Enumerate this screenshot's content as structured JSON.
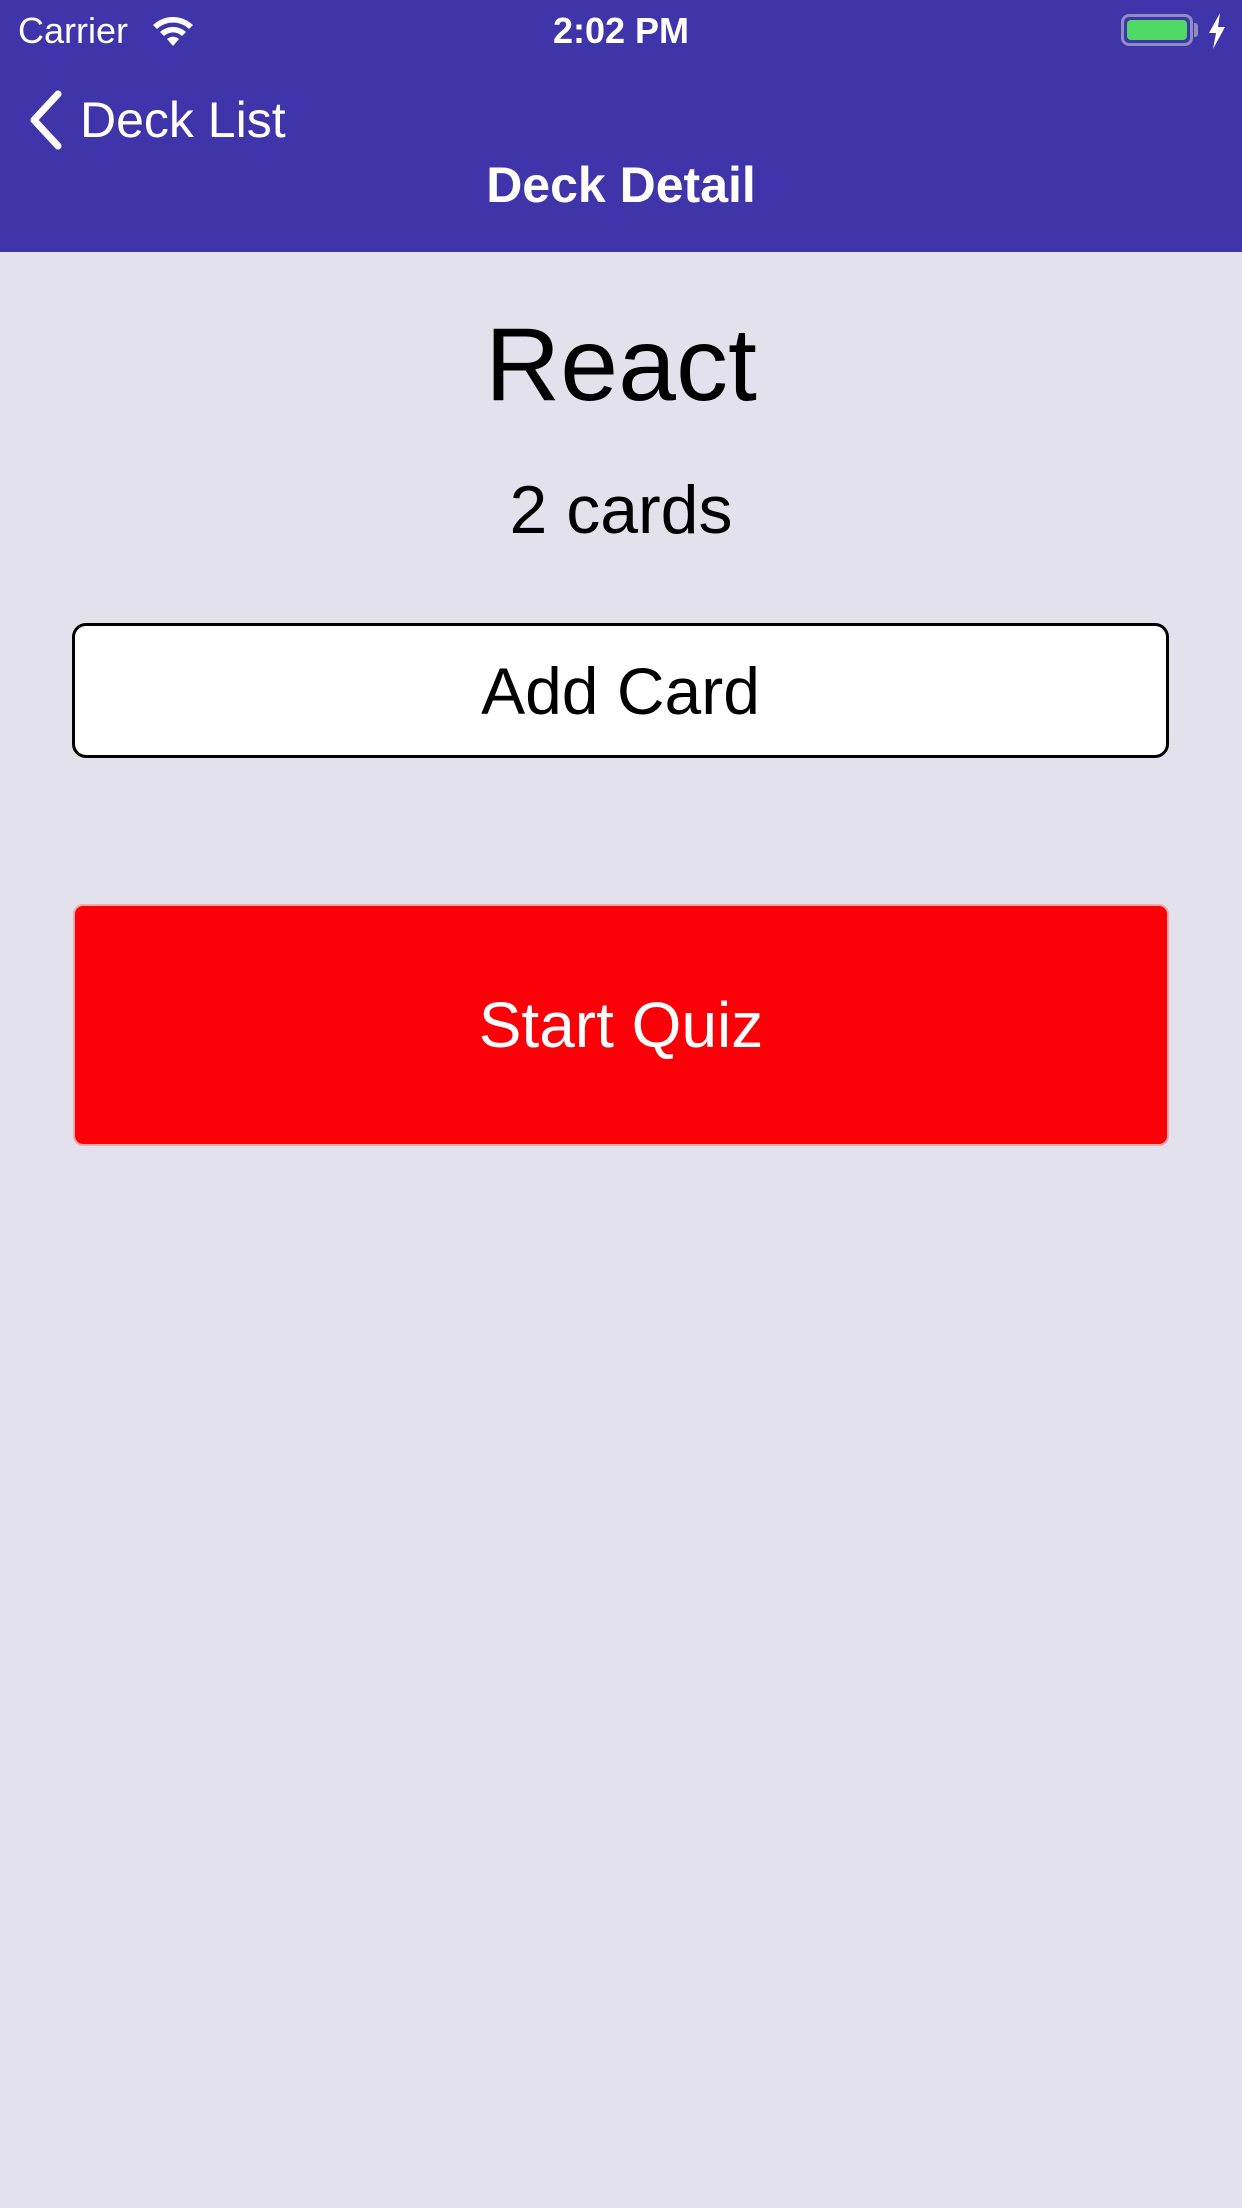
{
  "status_bar": {
    "carrier": "Carrier",
    "time": "2:02 PM",
    "battery_level": 1.0,
    "battery_color": "#4cd964",
    "icons": [
      "wifi-icon",
      "battery-icon",
      "charging-bolt-icon"
    ]
  },
  "nav": {
    "back_label": "Deck List",
    "back_icon": "chevron-left-icon",
    "title": "Deck Detail",
    "bar_color": "#4034ab"
  },
  "deck": {
    "title": "React",
    "card_count_label": "2 cards"
  },
  "actions": {
    "add_card_label": "Add Card",
    "start_quiz_label": "Start Quiz",
    "start_quiz_color": "#fc0007"
  },
  "theme": {
    "background": "#e3e2ec"
  }
}
